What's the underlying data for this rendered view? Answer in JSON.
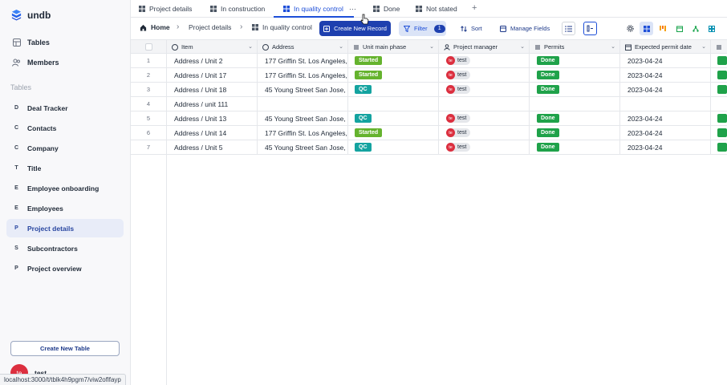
{
  "app": {
    "name": "undb",
    "status_url": "localhost:3000/t/tblk4h9pgm7/viw2oflfayp"
  },
  "sidebar": {
    "nav": [
      {
        "label": "Tables",
        "icon": "table-icon"
      },
      {
        "label": "Members",
        "icon": "users-icon"
      }
    ],
    "section_label": "Tables",
    "tables": [
      {
        "letter": "D",
        "label": "Deal Tracker"
      },
      {
        "letter": "C",
        "label": "Contacts"
      },
      {
        "letter": "C",
        "label": "Company"
      },
      {
        "letter": "T",
        "label": "Title"
      },
      {
        "letter": "E",
        "label": "Employee onboarding"
      },
      {
        "letter": "E",
        "label": "Employees"
      },
      {
        "letter": "P",
        "label": "Project details"
      },
      {
        "letter": "S",
        "label": "Subcontractors"
      },
      {
        "letter": "P",
        "label": "Project overview"
      }
    ],
    "active_table": "Project details",
    "create_table_label": "Create New Table",
    "user": {
      "initials": "te",
      "name": "test"
    }
  },
  "tabs": [
    {
      "label": "Project details"
    },
    {
      "label": "In construction"
    },
    {
      "label": "In quality control",
      "active": true
    },
    {
      "label": "Done"
    },
    {
      "label": "Not stated"
    }
  ],
  "toolbar": {
    "breadcrumb": [
      "Home",
      "Project details",
      "In quality control"
    ],
    "create_record_label": "Create New Record",
    "filter_label": "Filter",
    "filter_count": "1",
    "sort_label": "Sort",
    "manage_fields_label": "Manage Fields"
  },
  "columns": [
    {
      "label": "Item",
      "icon": "text-icon"
    },
    {
      "label": "Address",
      "icon": "text-icon"
    },
    {
      "label": "Unit main phase",
      "icon": "select-icon"
    },
    {
      "label": "Project manager",
      "icon": "user-icon"
    },
    {
      "label": "Permits",
      "icon": "select-icon"
    },
    {
      "label": "Expected permit date",
      "icon": "calendar-icon"
    }
  ],
  "rows": [
    {
      "num": "1",
      "item": "Address / Unit 2",
      "address": "177 Griffin St. Los Angeles, C",
      "phase": "Started",
      "pm": "test",
      "pm_initials": "te",
      "permits": "Done",
      "date": "2023-04-24"
    },
    {
      "num": "2",
      "item": "Address / Unit 17",
      "address": "177 Griffin St. Los Angeles, C",
      "phase": "Started",
      "pm": "test",
      "pm_initials": "te",
      "permits": "Done",
      "date": "2023-04-24"
    },
    {
      "num": "3",
      "item": "Address / Unit 18",
      "address": "45 Young Street San Jose, C",
      "phase": "QC",
      "pm": "test",
      "pm_initials": "te",
      "permits": "Done",
      "date": "2023-04-24"
    },
    {
      "num": "4",
      "item": "Address / unit 111",
      "address": "",
      "phase": "",
      "pm": "",
      "pm_initials": "",
      "permits": "",
      "date": ""
    },
    {
      "num": "5",
      "item": "Address / Unit 13",
      "address": "45 Young Street San Jose, C",
      "phase": "QC",
      "pm": "test",
      "pm_initials": "te",
      "permits": "Done",
      "date": "2023-04-24"
    },
    {
      "num": "6",
      "item": "Address / Unit 14",
      "address": "177 Griffin St. Los Angeles, C",
      "phase": "Started",
      "pm": "test",
      "pm_initials": "te",
      "permits": "Done",
      "date": "2023-04-24"
    },
    {
      "num": "7",
      "item": "Address / Unit 5",
      "address": "45 Young Street San Jose, C",
      "phase": "QC",
      "pm": "test",
      "pm_initials": "te",
      "permits": "Done",
      "date": "2023-04-24"
    }
  ],
  "colors": {
    "accent": "#1e40af",
    "started": "#65b32e",
    "qc": "#14a3a0",
    "done": "#1fa24a",
    "avatar": "#dc2f3f"
  }
}
